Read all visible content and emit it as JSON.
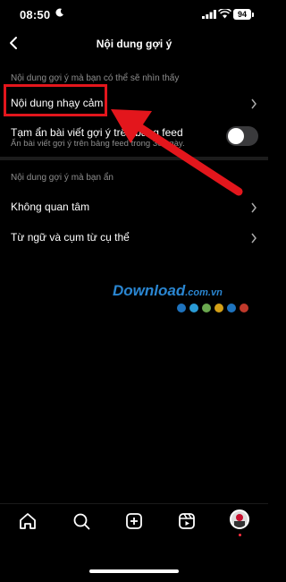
{
  "status_bar": {
    "time": "08:50",
    "battery": "94"
  },
  "header": {
    "title": "Nội dung gợi ý"
  },
  "sections": [
    {
      "title": "Nội dung gợi ý mà bạn có thể sẽ nhìn thấy",
      "items": [
        {
          "label": "Nội dung nhạy cảm"
        },
        {
          "label": "Tạm ẩn bài viết gợi ý trên bảng feed",
          "sublabel": "Ẩn bài viết gợi ý trên bảng feed trong 30 ngày.",
          "toggle": false
        }
      ]
    },
    {
      "title": "Nội dung gợi ý mà bạn ẩn",
      "items": [
        {
          "label": "Không quan tâm"
        },
        {
          "label": "Từ ngữ và cụm từ cụ thể"
        }
      ]
    }
  ],
  "watermark": {
    "text": "Download",
    "suffix": ".com.vn",
    "dot_colors": [
      "#1e73be",
      "#2a9bd6",
      "#6aa84f",
      "#d4a017",
      "#1e73be",
      "#c0392b"
    ]
  },
  "tabbar": {
    "icons": [
      "home-icon",
      "search-icon",
      "create-icon",
      "reels-icon",
      "profile-avatar"
    ]
  },
  "colors": {
    "highlight": "#e3161c",
    "background": "#000000"
  }
}
